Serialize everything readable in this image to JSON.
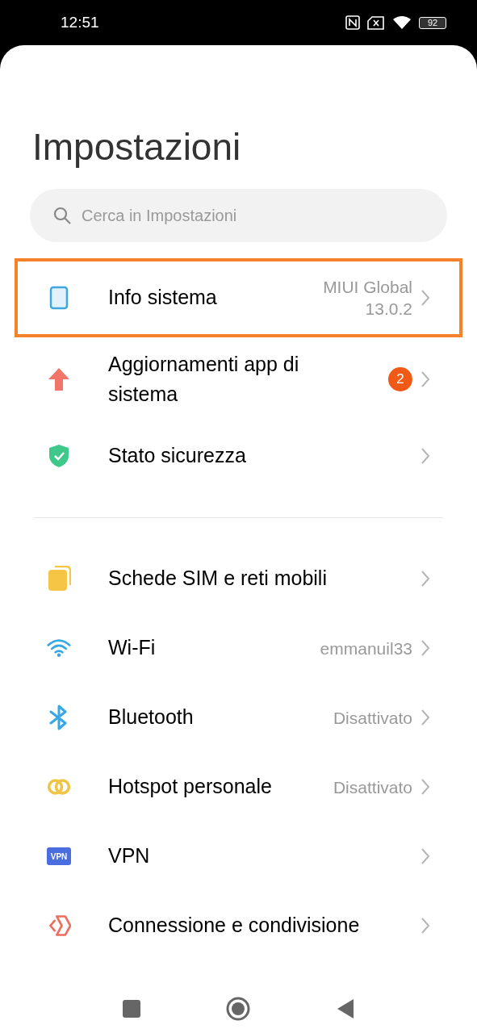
{
  "status_bar": {
    "time": "12:51",
    "battery": "92"
  },
  "title": "Impostazioni",
  "search": {
    "placeholder": "Cerca in Impostazioni"
  },
  "sections": [
    {
      "items": [
        {
          "kind": "device",
          "label": "Info sistema",
          "value": "MIUI Global 13.0.2",
          "highlighted": true
        },
        {
          "kind": "update",
          "label": "Aggiornamenti app di sistema",
          "badge": "2",
          "highlighted": false
        },
        {
          "kind": "shield",
          "label": "Stato sicurezza",
          "highlighted": false
        }
      ]
    },
    {
      "items": [
        {
          "kind": "sim",
          "label": "Schede SIM e reti mobili",
          "highlighted": false
        },
        {
          "kind": "wifi",
          "label": "Wi-Fi",
          "value": "emmanuil33",
          "highlighted": false
        },
        {
          "kind": "bluetooth",
          "label": "Bluetooth",
          "value": "Disattivato",
          "highlighted": false
        },
        {
          "kind": "hotspot",
          "label": "Hotspot personale",
          "value": "Disattivato",
          "highlighted": false
        },
        {
          "kind": "vpn",
          "label": "VPN",
          "icon_text": "VPN",
          "highlighted": false
        },
        {
          "kind": "share",
          "label": "Connessione e condivisione",
          "highlighted": false
        }
      ]
    }
  ]
}
